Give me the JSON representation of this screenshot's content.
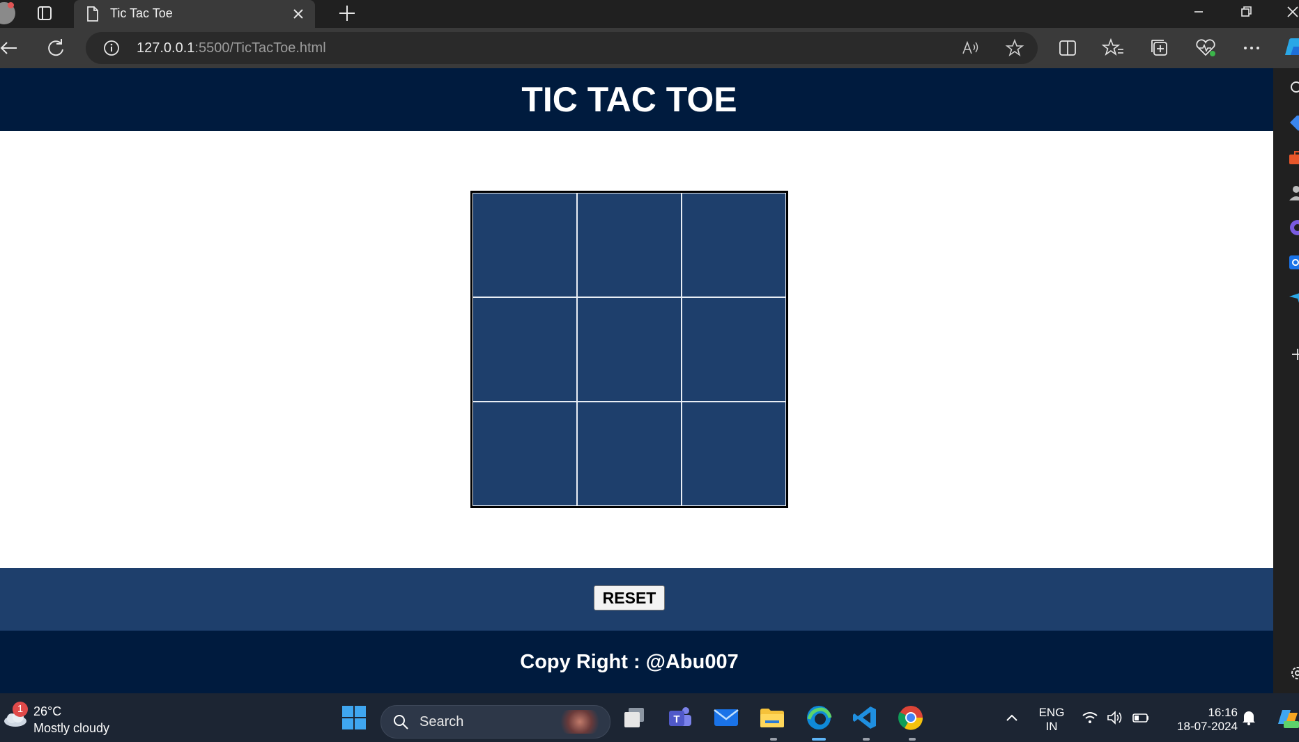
{
  "browser": {
    "tab_title": "Tic Tac Toe",
    "url_host": "127.0.0.1",
    "url_rest": ":5500/TicTacToe.html"
  },
  "page": {
    "title": "TIC TAC TOE",
    "board": {
      "cells": [
        "",
        "",
        "",
        "",
        "",
        "",
        "",
        "",
        ""
      ]
    },
    "reset_label": "RESET",
    "footer_text": "Copy Right : @Abu007",
    "colors": {
      "header_bg": "#001b3e",
      "board_bg": "#1e3f6c",
      "reset_bar_bg": "#1e3f6c",
      "footer_bg": "#001b3e"
    }
  },
  "taskbar": {
    "weather_badge": "1",
    "weather_temp": "26°C",
    "weather_desc": "Mostly cloudy",
    "search_label": "Search",
    "lang_top": "ENG",
    "lang_bottom": "IN",
    "time": "16:16",
    "date": "18-07-2024"
  }
}
